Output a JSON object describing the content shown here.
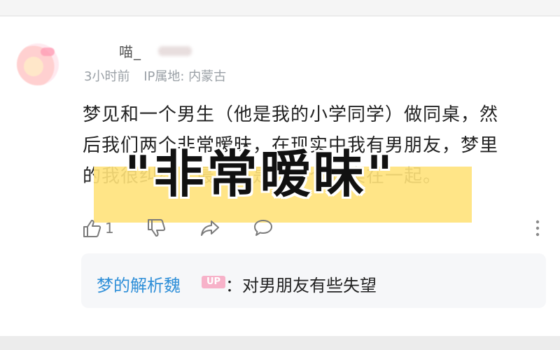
{
  "comment": {
    "username": "喵_",
    "meta_time": "3小时前",
    "meta_ip": "IP属地: 内蒙古",
    "lines": [
      "梦见和一个男生（他是我的小学同学）做同桌，然",
      "后我们两个非常暧昧，在现实中我有男朋友，梦里",
      "的我很纠结，最后还是跟那个同桌在一起。"
    ],
    "like_count": "1"
  },
  "overlay": {
    "caption": "\"非常暧昧\""
  },
  "reply": {
    "author": "梦的解析魏",
    "badge": "UP",
    "text": "：对男朋友有些失望"
  },
  "icons": [
    "thumb-up-icon",
    "thumb-down-icon",
    "share-icon",
    "comment-icon",
    "more-icon"
  ],
  "colors": {
    "reply_author": "#2f8fd8",
    "highlight": "#ffe27a",
    "badge": "#f7b2c9"
  }
}
